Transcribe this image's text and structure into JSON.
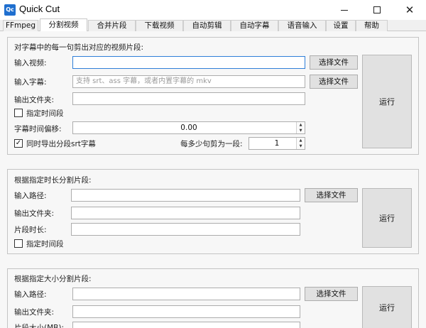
{
  "window": {
    "icon_text": "Qc",
    "title": "Quick Cut"
  },
  "tabs": [
    {
      "label": "FFmpeg",
      "active": false
    },
    {
      "label": "分割视频",
      "active": true
    },
    {
      "label": "合并片段",
      "active": false
    },
    {
      "label": "下载视频",
      "active": false
    },
    {
      "label": "自动剪辑",
      "active": false
    },
    {
      "label": "自动字幕",
      "active": false
    },
    {
      "label": "语音输入",
      "active": false
    },
    {
      "label": "设置",
      "active": false
    },
    {
      "label": "帮助",
      "active": false
    }
  ],
  "subtitle_split": {
    "title": "对字幕中的每一句剪出对应的视频片段:",
    "input_video_label": "输入视频:",
    "input_video_value": "",
    "choose_file_video": "选择文件",
    "input_subtitle_label": "输入字幕:",
    "input_subtitle_placeholder": "支持 srt、ass 字幕，或者内置字幕的 mkv",
    "choose_file_subtitle": "选择文件",
    "output_folder_label": "输出文件夹:",
    "output_folder_value": "",
    "specify_range_label": "指定时间段",
    "specify_range_checked": false,
    "offset_label": "字幕时间偏移:",
    "offset_value": "0.00",
    "export_srt_label": "同时导出分段srt字幕",
    "export_srt_checked": true,
    "per_segment_label": "每多少句剪为一段:",
    "per_segment_value": "1",
    "run_label": "运行"
  },
  "duration_split": {
    "title": "根据指定时长分割片段:",
    "input_path_label": "输入路径:",
    "input_path_value": "",
    "choose_file": "选择文件",
    "output_folder_label": "输出文件夹:",
    "output_folder_value": "",
    "segment_duration_label": "片段时长:",
    "segment_duration_value": "",
    "specify_range_label": "指定时间段",
    "specify_range_checked": false,
    "run_label": "运行"
  },
  "size_split": {
    "title": "根据指定大小分割片段:",
    "input_path_label": "输入路径:",
    "input_path_value": "",
    "choose_file": "选择文件",
    "output_folder_label": "输出文件夹:",
    "output_folder_value": "",
    "segment_size_label": "片段大小(MB):",
    "run_label": "运行"
  },
  "icons": {
    "minimize": "minimize-icon",
    "maximize": "maximize-icon",
    "close": "close-icon",
    "check": "✓",
    "spin_up": "▲",
    "spin_down": "▼"
  },
  "colors": {
    "focus_border": "#2f7fd8",
    "app_icon": "#1f6fcf"
  }
}
